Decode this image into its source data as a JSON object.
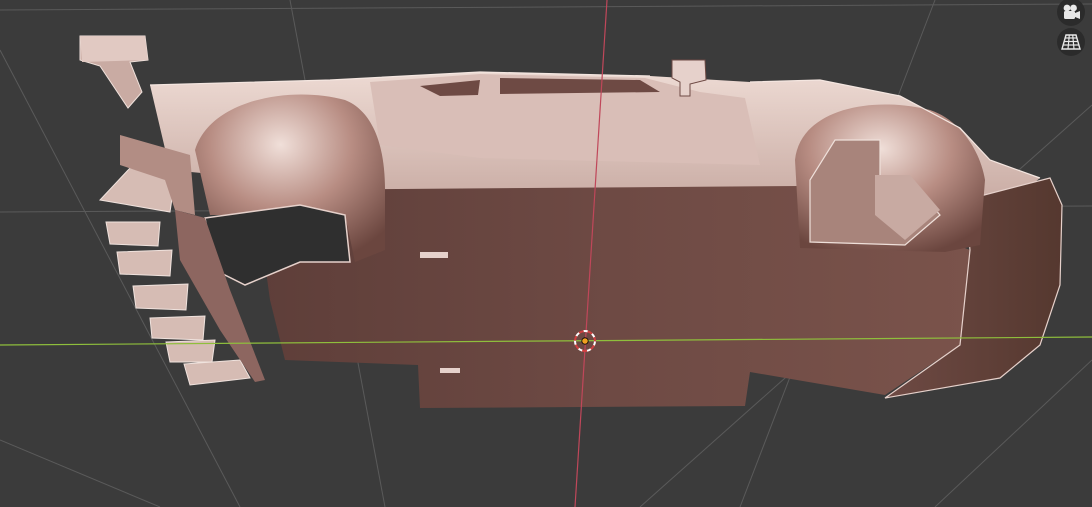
{
  "app": "Blender",
  "viewport": {
    "shading": "solid",
    "overlays": {
      "floor_grid": true,
      "x_axis": true,
      "y_axis": true,
      "origin_marker": true
    },
    "colors": {
      "background": "#3b3b3b",
      "grid": "#5a5a5a",
      "x_axis": "#8fbf3c",
      "y_axis": "#c0475a",
      "model_base": "#6d4a44",
      "model_highlight": "#e6d1cb",
      "origin_fill": "#f0a020"
    },
    "object": {
      "name_shown": false,
      "type": "car body mesh"
    }
  },
  "navigation_gizmo": {
    "buttons": [
      {
        "id": "camera",
        "icon": "camera-view-icon"
      },
      {
        "id": "perspective",
        "icon": "perspective-grid-icon"
      }
    ]
  }
}
